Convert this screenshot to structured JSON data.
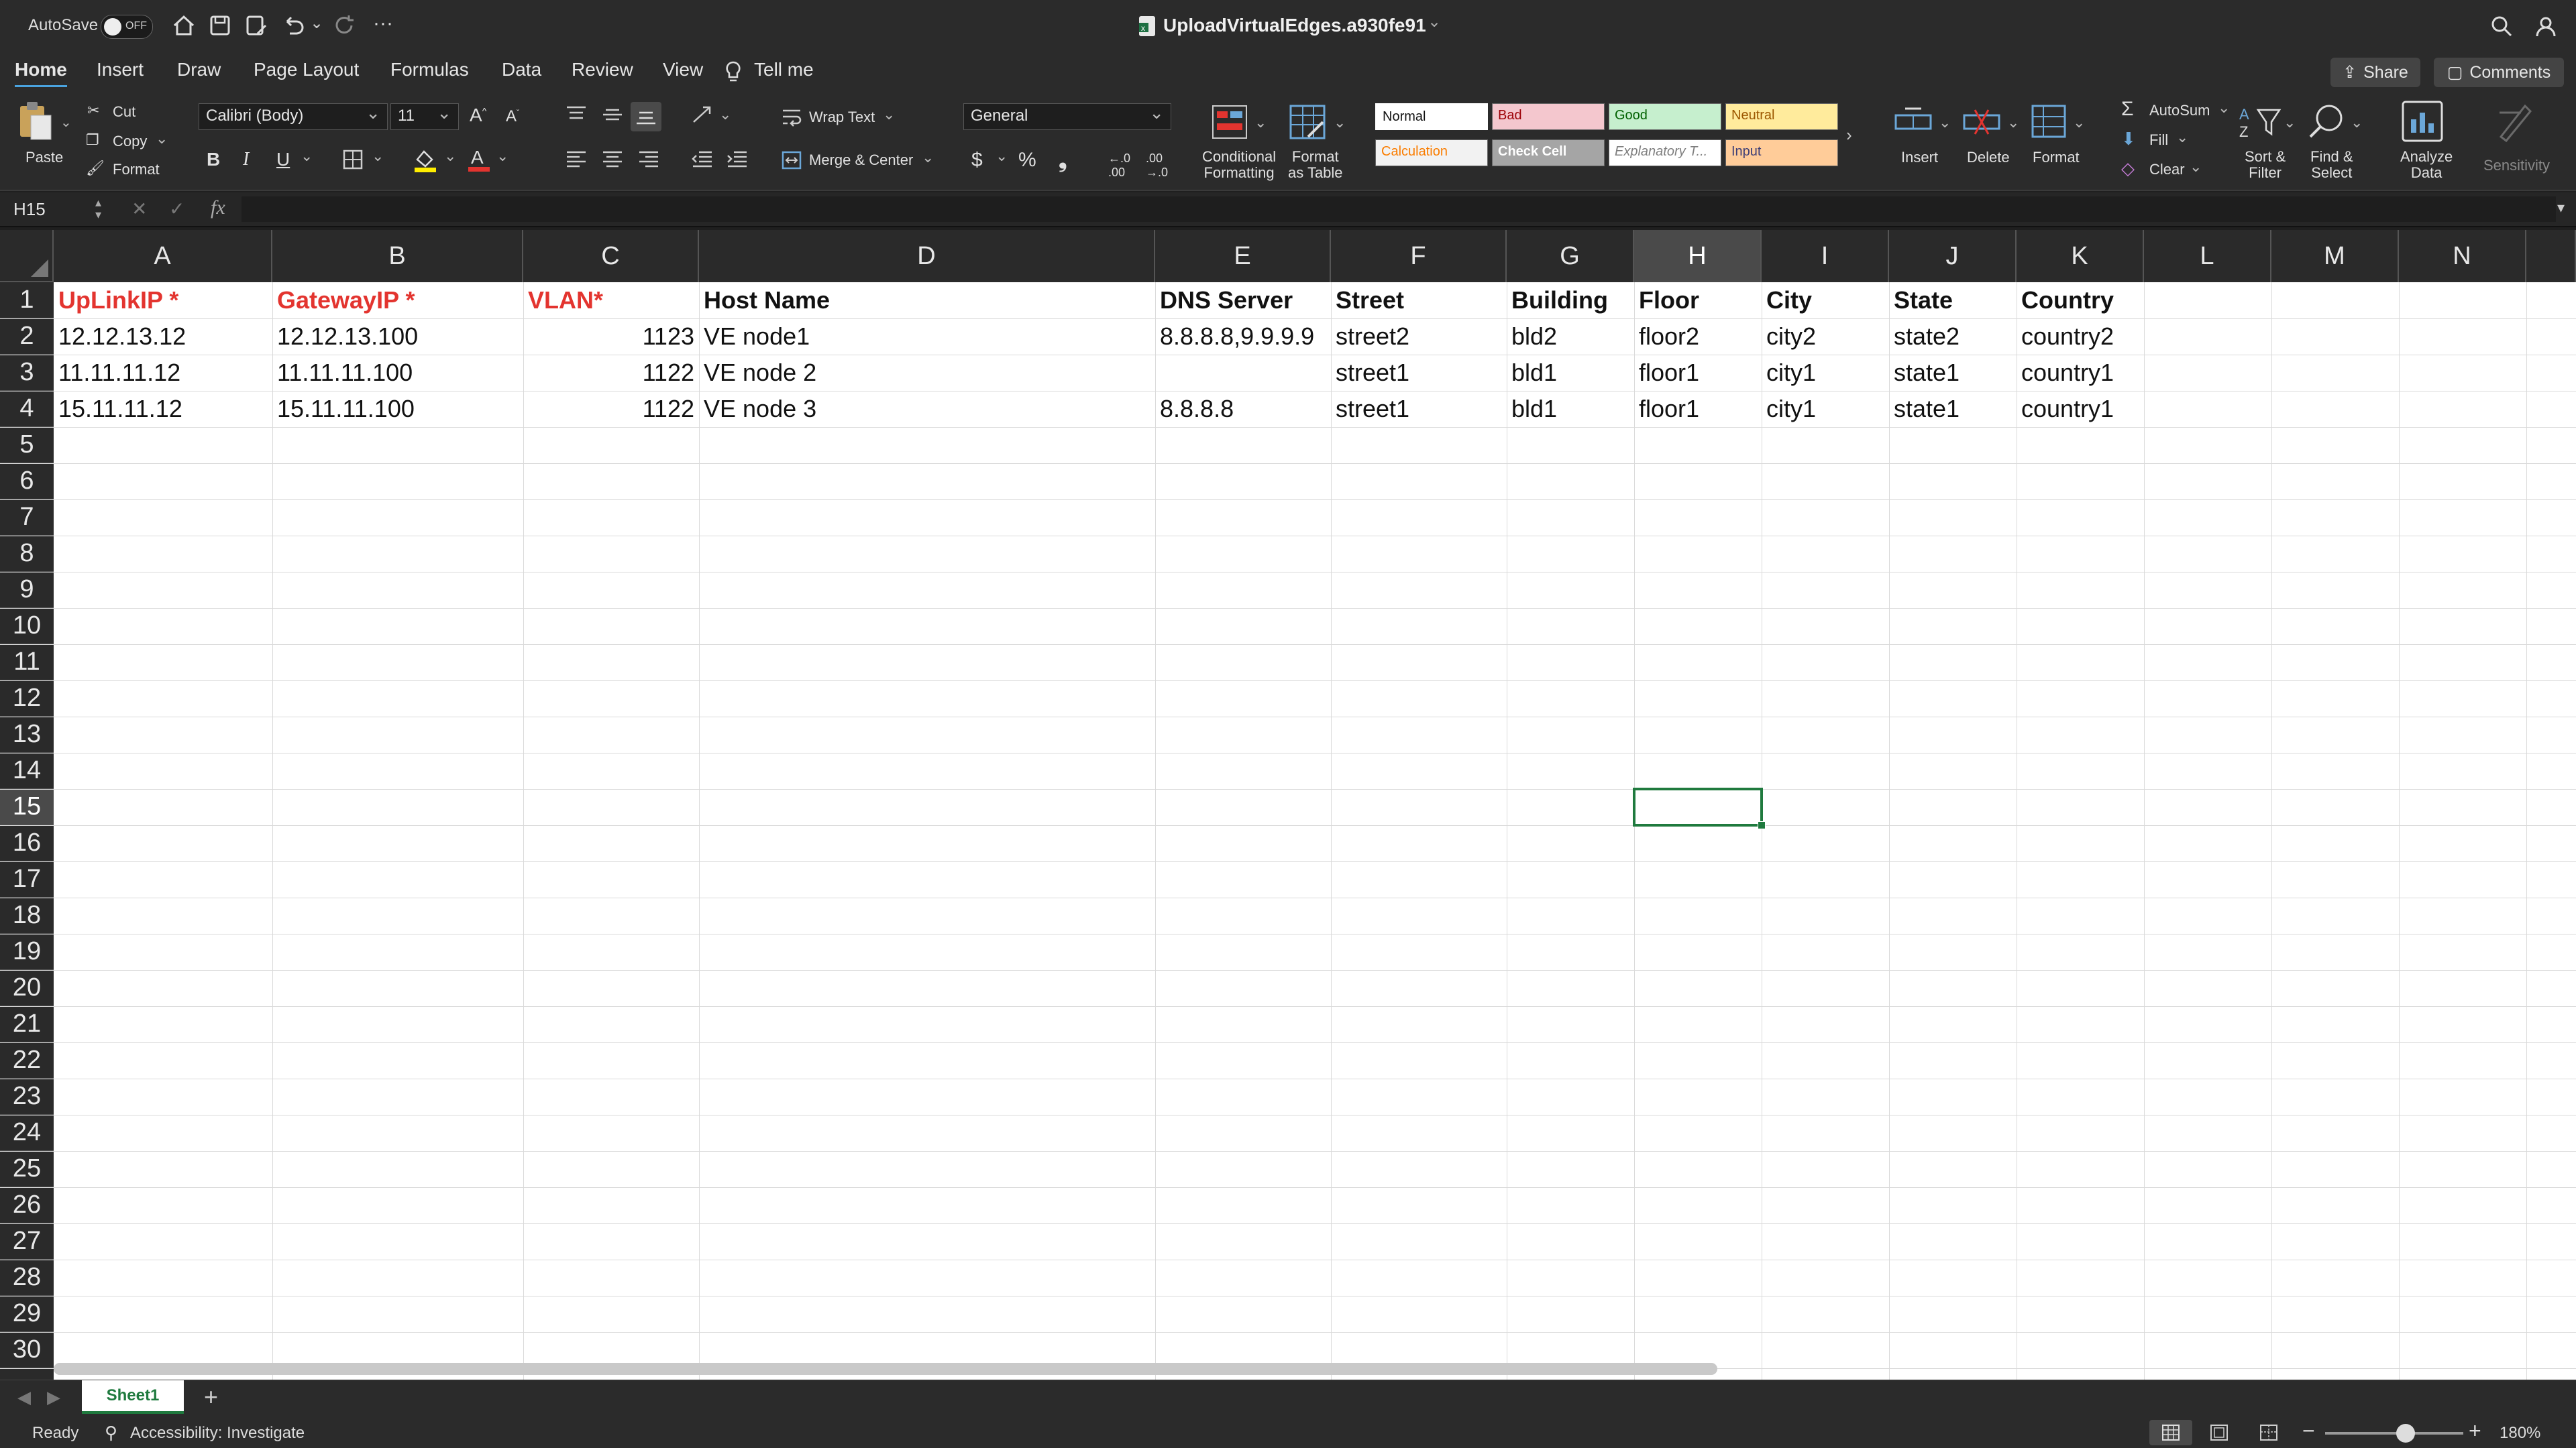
{
  "titlebar": {
    "autosave_label": "AutoSave",
    "autosave_state": "OFF",
    "doc_title": "UploadVirtualEdges.a930fe91",
    "more": "···"
  },
  "tabs": [
    {
      "label": "Home",
      "active": true
    },
    {
      "label": "Insert"
    },
    {
      "label": "Draw"
    },
    {
      "label": "Page Layout"
    },
    {
      "label": "Formulas"
    },
    {
      "label": "Data"
    },
    {
      "label": "Review"
    },
    {
      "label": "View"
    },
    {
      "label": "Tell me"
    }
  ],
  "share_label": "Share",
  "comments_label": "Comments",
  "ribbon": {
    "paste": "Paste",
    "cut": "Cut",
    "copy": "Copy",
    "format_painter": "Format",
    "font_name": "Calibri (Body)",
    "font_size": "11",
    "bold": "B",
    "italic": "I",
    "underline": "U",
    "wrap_text": "Wrap Text",
    "merge_center": "Merge & Center",
    "number_format": "General",
    "conditional_formatting": [
      "Conditional",
      "Formatting"
    ],
    "format_as_table": [
      "Format",
      "as Table"
    ],
    "styles": [
      {
        "label": "Normal",
        "bg": "#ffffff",
        "fg": "#111111"
      },
      {
        "label": "Bad",
        "bg": "#f4c7ce",
        "fg": "#9c0006"
      },
      {
        "label": "Good",
        "bg": "#c6efce",
        "fg": "#006100"
      },
      {
        "label": "Neutral",
        "bg": "#ffeb9c",
        "fg": "#9c5700"
      },
      {
        "label": "Calculation",
        "bg": "#f2f2f2",
        "fg": "#fa7d00"
      },
      {
        "label": "Check Cell",
        "bg": "#a5a5a5",
        "fg": "#ffffff"
      },
      {
        "label": "Explanatory T...",
        "bg": "#ffffff",
        "fg": "#7f7f7f"
      },
      {
        "label": "Input",
        "bg": "#ffcc99",
        "fg": "#3f3f76"
      }
    ],
    "insert": "Insert",
    "delete": "Delete",
    "format": "Format",
    "autosum": "AutoSum",
    "fill": "Fill",
    "clear": "Clear",
    "sort_filter": [
      "Sort &",
      "Filter"
    ],
    "find_select": [
      "Find &",
      "Select"
    ],
    "analyze_data": [
      "Analyze",
      "Data"
    ],
    "sensitivity": "Sensitivity"
  },
  "formula_bar": {
    "name_box": "H15",
    "fx": "fx",
    "value": ""
  },
  "grid": {
    "columns": [
      "A",
      "B",
      "C",
      "D",
      "E",
      "F",
      "G",
      "H",
      "I",
      "J",
      "K",
      "L",
      "M",
      "N"
    ],
    "selected_column": "H",
    "selected_row": "15",
    "rows_visible": [
      "1",
      "2",
      "3",
      "4",
      "5",
      "6",
      "7",
      "8",
      "9",
      "10",
      "11",
      "12",
      "13",
      "14",
      "15",
      "16",
      "17",
      "18",
      "19",
      "20",
      "21",
      "22",
      "23",
      "24",
      "25",
      "26",
      "27",
      "28",
      "29",
      "30"
    ],
    "header_row": [
      "UpLinkIP *",
      "GatewayIP *",
      "VLAN*",
      "Host Name",
      "DNS Server",
      "Street",
      "Building",
      "Floor",
      "City",
      "State",
      "Country"
    ],
    "data_rows": [
      [
        "12.12.13.12",
        "12.12.13.100",
        "1123",
        "VE node1",
        "8.8.8.8,9.9.9.9",
        "street2",
        "bld2",
        "floor2",
        "city2",
        "state2",
        "country2"
      ],
      [
        "11.11.11.12",
        "11.11.11.100",
        "1122",
        "VE node 2",
        "",
        "street1",
        "bld1",
        "floor1",
        "city1",
        "state1",
        "country1"
      ],
      [
        "15.11.11.12",
        "15.11.11.100",
        "1122",
        "VE node 3",
        "8.8.8.8",
        "street1",
        "bld1",
        "floor1",
        "city1",
        "state1",
        "country1"
      ]
    ]
  },
  "sheet_tab": "Sheet1",
  "add_sheet": "+",
  "status": {
    "ready": "Ready",
    "accessibility": "Accessibility: Investigate",
    "zoom": "180%"
  },
  "colors": {
    "accent": "#4aa3df",
    "required_header": "#e3342f",
    "selection": "#1f7a3e"
  }
}
